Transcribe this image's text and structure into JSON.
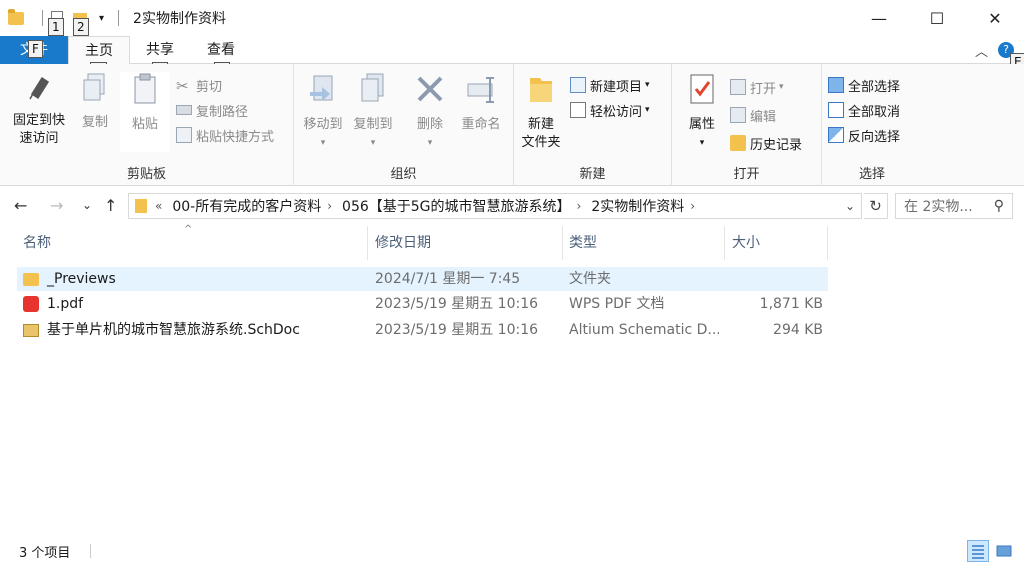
{
  "window": {
    "title": "2实物制作资料",
    "keytip_1": "1",
    "keytip_2": "2",
    "minimize_label": "—",
    "maximize_label": "☐",
    "close_label": "✕"
  },
  "ribbon_tabs": [
    {
      "label": "文件",
      "keytip": "F"
    },
    {
      "label": "主页",
      "keytip": "H"
    },
    {
      "label": "共享",
      "keytip": "S"
    },
    {
      "label": "查看",
      "keytip": "V"
    }
  ],
  "ribbon_right": {
    "collapse": "︿",
    "help_keytip": "E"
  },
  "clipboard": {
    "pin_label_1": "固定到快",
    "pin_label_2": "速访问",
    "copy": "复制",
    "paste": "粘贴",
    "cut": "剪切",
    "copy_path": "复制路径",
    "paste_shortcut": "粘贴快捷方式",
    "group": "剪贴板"
  },
  "organize": {
    "move_to": "移动到",
    "copy_to": "复制到",
    "delete": "删除",
    "rename": "重命名",
    "group": "组织"
  },
  "new": {
    "new_folder_1": "新建",
    "new_folder_2": "文件夹",
    "new_item": "新建项目",
    "easy_access": "轻松访问",
    "group": "新建"
  },
  "open": {
    "properties": "属性",
    "open": "打开",
    "edit": "编辑",
    "history": "历史记录",
    "group": "打开"
  },
  "select": {
    "select_all": "全部选择",
    "select_none": "全部取消",
    "invert": "反向选择",
    "group": "选择"
  },
  "nav": {
    "back": "←",
    "forward": "→",
    "recent": "⌄",
    "up": "↑",
    "overflow": "«",
    "crumbs": [
      "00-所有完成的客户资料",
      "056【基于5G的城市智慧旅游系统】",
      "2实物制作资料"
    ],
    "refresh": "↻",
    "search_placeholder": "在 2实物..."
  },
  "columns": {
    "name": "名称",
    "date": "修改日期",
    "type": "类型",
    "size": "大小"
  },
  "files": [
    {
      "name": "_Previews",
      "date": "2024/7/1 星期一 7:45",
      "type": "文件夹",
      "size": "",
      "icon": "folder-icon"
    },
    {
      "name": "1.pdf",
      "date": "2023/5/19 星期五 10:16",
      "type": "WPS PDF 文档",
      "size": "1,871 KB",
      "icon": "pdf-icon"
    },
    {
      "name": "基于单片机的城市智慧旅游系统.SchDoc",
      "date": "2023/5/19 星期五 10:16",
      "type": "Altium Schematic D...",
      "size": "294 KB",
      "icon": "schdoc-icon"
    }
  ],
  "status": {
    "count": "3 个项目"
  },
  "colors": {
    "accent": "#1979ca",
    "folder": "#f2c14e",
    "selected_row": "#e5f3ff"
  }
}
